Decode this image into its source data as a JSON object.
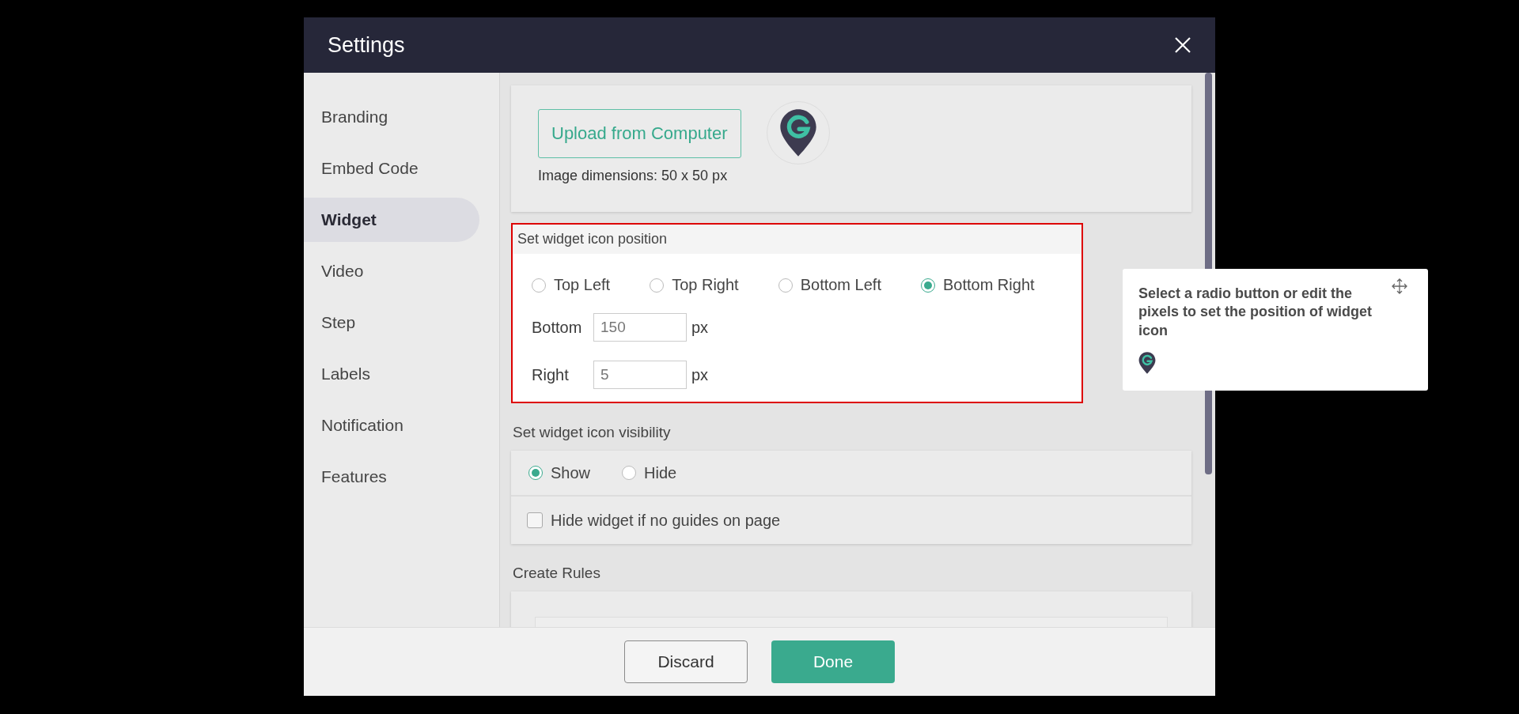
{
  "dialog": {
    "title": "Settings"
  },
  "sidebar": {
    "items": [
      {
        "label": "Branding",
        "selected": false
      },
      {
        "label": "Embed Code",
        "selected": false
      },
      {
        "label": "Widget",
        "selected": true
      },
      {
        "label": "Video",
        "selected": false
      },
      {
        "label": "Step",
        "selected": false
      },
      {
        "label": "Labels",
        "selected": false
      },
      {
        "label": "Notification",
        "selected": false
      },
      {
        "label": "Features",
        "selected": false
      }
    ]
  },
  "upload": {
    "button": "Upload from Computer",
    "hint": "Image dimensions: 50 x 50 px"
  },
  "position": {
    "heading": "Set widget icon position",
    "highlighted": true,
    "options": [
      {
        "label": "Top Left",
        "selected": false
      },
      {
        "label": "Top Right",
        "selected": false
      },
      {
        "label": "Bottom Left",
        "selected": false
      },
      {
        "label": "Bottom Right",
        "selected": true
      }
    ],
    "fields": [
      {
        "label": "Bottom",
        "value": "150",
        "unit": "px"
      },
      {
        "label": "Right",
        "value": "5",
        "unit": "px"
      }
    ]
  },
  "visibility": {
    "heading": "Set widget icon visibility",
    "options": [
      {
        "label": "Show",
        "selected": true
      },
      {
        "label": "Hide",
        "selected": false
      }
    ],
    "checkbox": {
      "label": "Hide widget if no guides on page",
      "checked": false
    }
  },
  "rules": {
    "heading": "Create Rules"
  },
  "footer": {
    "buttons": [
      {
        "label": "Discard",
        "kind": "secondary"
      },
      {
        "label": "Done",
        "kind": "primary"
      }
    ]
  },
  "tooltip": {
    "text": "Select a radio button or edit the pixels to set the position of widget icon"
  }
}
